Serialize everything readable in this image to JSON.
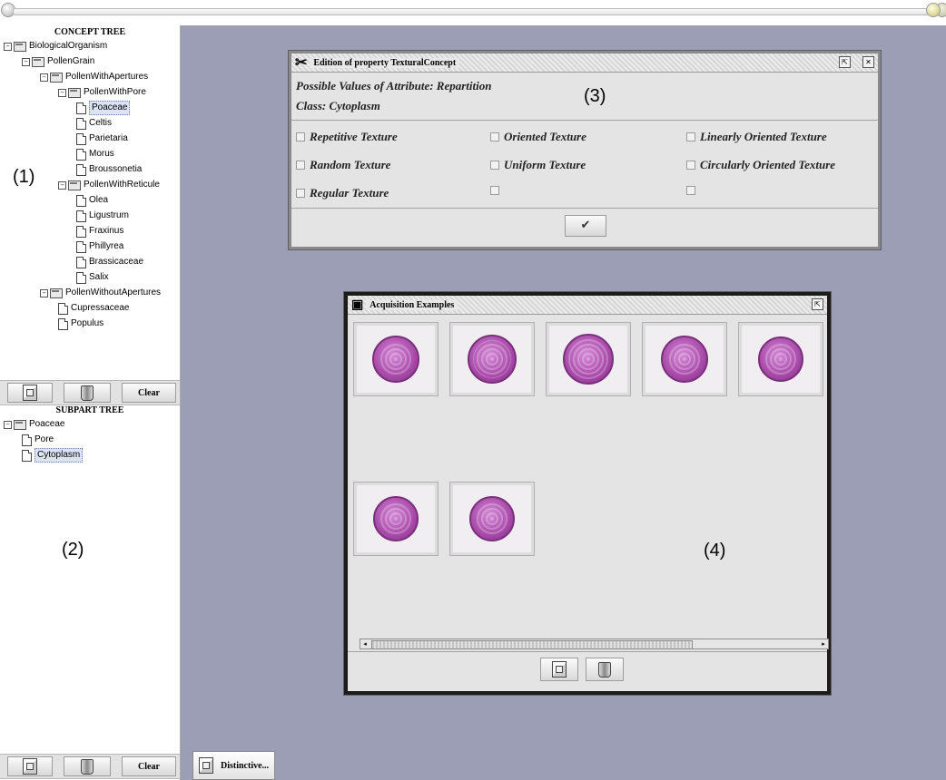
{
  "annotations": {
    "a1": "(1)",
    "a2": "(2)",
    "a3": "(3)",
    "a4": "(4)"
  },
  "concept_tree": {
    "title": "CONCEPT TREE",
    "nodes": [
      {
        "label": "BiologicalOrganism",
        "type": "folder"
      },
      {
        "label": "PollenGrain",
        "type": "folder"
      },
      {
        "label": "PollenWithApertures",
        "type": "folder"
      },
      {
        "label": "PollenWithPore",
        "type": "folder"
      },
      {
        "label": "Poaceae",
        "type": "doc",
        "selected": true
      },
      {
        "label": "Celtis",
        "type": "doc"
      },
      {
        "label": "Parietaria",
        "type": "doc"
      },
      {
        "label": "Morus",
        "type": "doc"
      },
      {
        "label": "Broussonetia",
        "type": "doc"
      },
      {
        "label": "PollenWithReticule",
        "type": "folder"
      },
      {
        "label": "Olea",
        "type": "doc"
      },
      {
        "label": "Ligustrum",
        "type": "doc"
      },
      {
        "label": "Fraxinus",
        "type": "doc"
      },
      {
        "label": "Phillyrea",
        "type": "doc"
      },
      {
        "label": "Brassicaceae",
        "type": "doc"
      },
      {
        "label": "Salix",
        "type": "doc"
      },
      {
        "label": "PollenWithoutApertures",
        "type": "folder"
      },
      {
        "label": "Cupressaceae",
        "type": "doc"
      },
      {
        "label": "Populus",
        "type": "doc"
      }
    ],
    "toolbar": {
      "add_icon": "add-document-icon",
      "trash_icon": "trash-icon",
      "clear_label": "Clear"
    }
  },
  "subpart_tree": {
    "title": "SUBPART TREE",
    "nodes": [
      {
        "label": "Poaceae",
        "type": "folder"
      },
      {
        "label": "Pore",
        "type": "doc"
      },
      {
        "label": "Cytoplasm",
        "type": "doc",
        "selected": true
      }
    ],
    "toolbar": {
      "add_icon": "add-document-icon",
      "trash_icon": "trash-icon",
      "clear_label": "Clear"
    }
  },
  "property_window": {
    "title": "Edition of property TexturalConcept",
    "heading1": "Possible Values of Attribute: Repartition",
    "heading2": "Class: Cytoplasm",
    "options": [
      [
        "Repetitive Texture",
        "Oriented Texture",
        "Linearly Oriented Texture"
      ],
      [
        "Random Texture",
        "Uniform Texture",
        "Circularly Oriented Texture"
      ],
      [
        "Regular Texture",
        "",
        ""
      ]
    ],
    "ok_symbol": "✔"
  },
  "acquisition_window": {
    "title": "Acquisition Examples",
    "image_count": 7
  },
  "taskbar": {
    "distinctive_label": "Distinctive..."
  }
}
